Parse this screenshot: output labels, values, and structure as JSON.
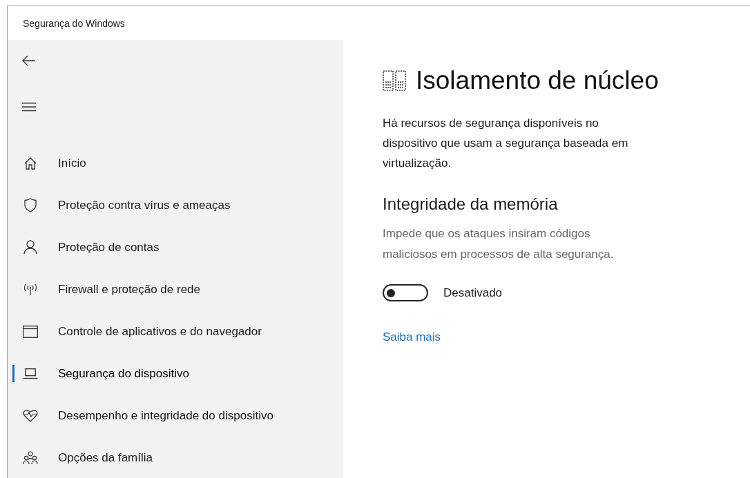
{
  "window": {
    "title": "Segurança do Windows"
  },
  "sidebar": {
    "items": [
      {
        "kind": "home",
        "label": "Início",
        "selected": false
      },
      {
        "kind": "shield",
        "label": "Proteção contra vírus e ameaças",
        "selected": false
      },
      {
        "kind": "person",
        "label": "Proteção de contas",
        "selected": false
      },
      {
        "kind": "antenna",
        "label": "Firewall e proteção de rede",
        "selected": false
      },
      {
        "kind": "window",
        "label": "Controle de aplicativos e do navegador",
        "selected": false
      },
      {
        "kind": "laptop",
        "label": "Segurança do dispositivo",
        "selected": true
      },
      {
        "kind": "heart",
        "label": "Desempenho e integridade do dispositivo",
        "selected": false
      },
      {
        "kind": "family",
        "label": "Opções da família",
        "selected": false
      }
    ]
  },
  "page": {
    "title": "Isolamento de núcleo",
    "description": "Há recursos de segurança disponíveis no dispositivo que usam a segurança baseada em virtualização.",
    "section": {
      "title": "Integridade da memória",
      "description": "Impede que os ataques insiram códigos maliciosos em processos de alta segurança.",
      "toggle": {
        "on": false,
        "label": "Desativado"
      },
      "link": "Saiba mais"
    }
  }
}
